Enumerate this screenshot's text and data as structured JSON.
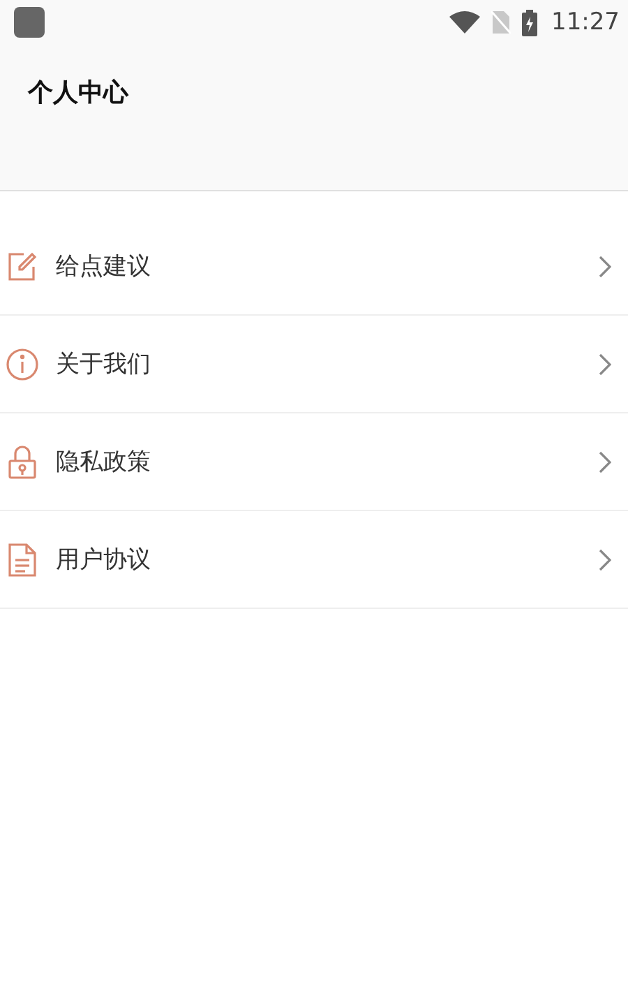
{
  "status_bar": {
    "time": "11:27"
  },
  "header": {
    "title": "个人中心"
  },
  "menu": [
    {
      "kind": "edit",
      "label": "给点建议"
    },
    {
      "kind": "info",
      "label": "关于我们"
    },
    {
      "kind": "lock",
      "label": "隐私政策"
    },
    {
      "kind": "document",
      "label": "用户协议"
    }
  ]
}
